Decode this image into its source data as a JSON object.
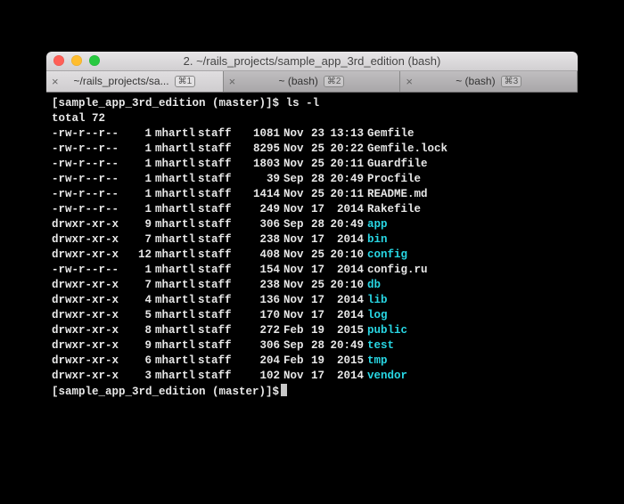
{
  "titlebar": {
    "title": "2. ~/rails_projects/sample_app_3rd_edition (bash)"
  },
  "tabs": [
    {
      "label": "~/rails_projects/sa...",
      "shortcut": "⌘1",
      "active": true
    },
    {
      "label": "~ (bash)",
      "shortcut": "⌘2",
      "active": false
    },
    {
      "label": "~ (bash)",
      "shortcut": "⌘3",
      "active": false
    }
  ],
  "prompt": {
    "ps1": "[sample_app_3rd_edition (master)]$",
    "command": "ls -l"
  },
  "total_line": "total 72",
  "listing": [
    {
      "perm": "-rw-r--r--",
      "links": "1",
      "owner": "mhartl",
      "group": "staff",
      "size": "1081",
      "month": "Nov",
      "day": "23",
      "time": "13:13",
      "name": "Gemfile",
      "color": "file"
    },
    {
      "perm": "-rw-r--r--",
      "links": "1",
      "owner": "mhartl",
      "group": "staff",
      "size": "8295",
      "month": "Nov",
      "day": "25",
      "time": "20:22",
      "name": "Gemfile.lock",
      "color": "file"
    },
    {
      "perm": "-rw-r--r--",
      "links": "1",
      "owner": "mhartl",
      "group": "staff",
      "size": "1803",
      "month": "Nov",
      "day": "25",
      "time": "20:11",
      "name": "Guardfile",
      "color": "file"
    },
    {
      "perm": "-rw-r--r--",
      "links": "1",
      "owner": "mhartl",
      "group": "staff",
      "size": "39",
      "month": "Sep",
      "day": "28",
      "time": "20:49",
      "name": "Procfile",
      "color": "file"
    },
    {
      "perm": "-rw-r--r--",
      "links": "1",
      "owner": "mhartl",
      "group": "staff",
      "size": "1414",
      "month": "Nov",
      "day": "25",
      "time": "20:11",
      "name": "README.md",
      "color": "file"
    },
    {
      "perm": "-rw-r--r--",
      "links": "1",
      "owner": "mhartl",
      "group": "staff",
      "size": "249",
      "month": "Nov",
      "day": "17",
      "time": "2014",
      "name": "Rakefile",
      "color": "file"
    },
    {
      "perm": "drwxr-xr-x",
      "links": "9",
      "owner": "mhartl",
      "group": "staff",
      "size": "306",
      "month": "Sep",
      "day": "28",
      "time": "20:49",
      "name": "app",
      "color": "dir"
    },
    {
      "perm": "drwxr-xr-x",
      "links": "7",
      "owner": "mhartl",
      "group": "staff",
      "size": "238",
      "month": "Nov",
      "day": "17",
      "time": "2014",
      "name": "bin",
      "color": "dir"
    },
    {
      "perm": "drwxr-xr-x",
      "links": "12",
      "owner": "mhartl",
      "group": "staff",
      "size": "408",
      "month": "Nov",
      "day": "25",
      "time": "20:10",
      "name": "config",
      "color": "dir"
    },
    {
      "perm": "-rw-r--r--",
      "links": "1",
      "owner": "mhartl",
      "group": "staff",
      "size": "154",
      "month": "Nov",
      "day": "17",
      "time": "2014",
      "name": "config.ru",
      "color": "file"
    },
    {
      "perm": "drwxr-xr-x",
      "links": "7",
      "owner": "mhartl",
      "group": "staff",
      "size": "238",
      "month": "Nov",
      "day": "25",
      "time": "20:10",
      "name": "db",
      "color": "dir"
    },
    {
      "perm": "drwxr-xr-x",
      "links": "4",
      "owner": "mhartl",
      "group": "staff",
      "size": "136",
      "month": "Nov",
      "day": "17",
      "time": "2014",
      "name": "lib",
      "color": "dir"
    },
    {
      "perm": "drwxr-xr-x",
      "links": "5",
      "owner": "mhartl",
      "group": "staff",
      "size": "170",
      "month": "Nov",
      "day": "17",
      "time": "2014",
      "name": "log",
      "color": "dir"
    },
    {
      "perm": "drwxr-xr-x",
      "links": "8",
      "owner": "mhartl",
      "group": "staff",
      "size": "272",
      "month": "Feb",
      "day": "19",
      "time": "2015",
      "name": "public",
      "color": "dir"
    },
    {
      "perm": "drwxr-xr-x",
      "links": "9",
      "owner": "mhartl",
      "group": "staff",
      "size": "306",
      "month": "Sep",
      "day": "28",
      "time": "20:49",
      "name": "test",
      "color": "dir"
    },
    {
      "perm": "drwxr-xr-x",
      "links": "6",
      "owner": "mhartl",
      "group": "staff",
      "size": "204",
      "month": "Feb",
      "day": "19",
      "time": "2015",
      "name": "tmp",
      "color": "dir"
    },
    {
      "perm": "drwxr-xr-x",
      "links": "3",
      "owner": "mhartl",
      "group": "staff",
      "size": "102",
      "month": "Nov",
      "day": "17",
      "time": "2014",
      "name": "vendor",
      "color": "dir"
    }
  ],
  "prompt2": {
    "ps1": "[sample_app_3rd_edition (master)]$"
  }
}
